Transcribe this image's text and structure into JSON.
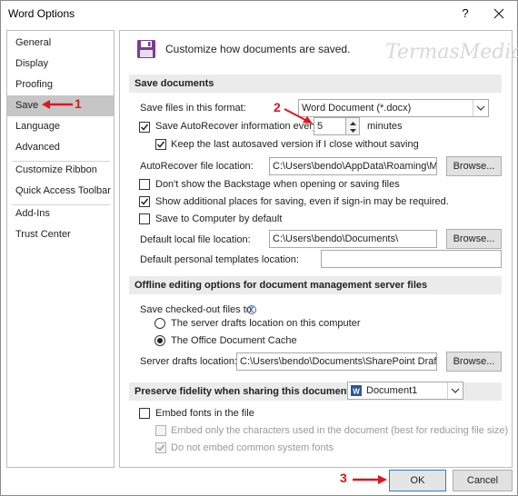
{
  "window": {
    "title": "Word Options",
    "help_label": "?"
  },
  "watermark": "TermasMedia",
  "nav": {
    "items": [
      {
        "label": "General"
      },
      {
        "label": "Display"
      },
      {
        "label": "Proofing"
      },
      {
        "label": "Save",
        "selected": true
      },
      {
        "label": "Language"
      },
      {
        "label": "Advanced"
      },
      {
        "label": "Customize Ribbon"
      },
      {
        "label": "Quick Access Toolbar"
      },
      {
        "label": "Add-Ins"
      },
      {
        "label": "Trust Center"
      }
    ]
  },
  "header": {
    "text": "Customize how documents are saved.",
    "icon": "save-disk-icon"
  },
  "save_documents": {
    "section_title": "Save documents",
    "format_label": "Save files in this format:",
    "format_value": "Word Document (*.docx)",
    "autorecover_label": "Save AutoRecover information every",
    "autorecover_checked": true,
    "autorecover_minutes": "5",
    "minutes_label": "minutes",
    "keep_last_label": "Keep the last autosaved version if I close without saving",
    "keep_last_checked": true,
    "autorecover_location_label": "AutoRecover file location:",
    "autorecover_location_value": "C:\\Users\\bendo\\AppData\\Roaming\\Mic",
    "browse_label": "Browse...",
    "dont_show_backstage_label": "Don't show the Backstage when opening or saving files",
    "dont_show_backstage_checked": false,
    "show_additional_label": "Show additional places for saving, even if sign-in may be required.",
    "show_additional_checked": true,
    "save_to_computer_label": "Save to Computer by default",
    "save_to_computer_checked": false,
    "default_local_label": "Default local file location:",
    "default_local_value": "C:\\Users\\bendo\\Documents\\",
    "default_templates_label": "Default personal templates location:",
    "default_templates_value": ""
  },
  "offline": {
    "section_title": "Offline editing options for document management server files",
    "save_checked_out_label": "Save checked-out files to:",
    "radio_server_label": "The server drafts location on this computer",
    "radio_cache_label": "The Office Document Cache",
    "selected": "cache",
    "server_drafts_label": "Server drafts location:",
    "server_drafts_value": "C:\\Users\\bendo\\Documents\\SharePoint Drafts\\",
    "browse_label": "Browse..."
  },
  "fidelity": {
    "section_title": "Preserve fidelity when sharing this document:",
    "document_value": "Document1",
    "embed_fonts_label": "Embed fonts in the file",
    "embed_fonts_checked": false,
    "embed_only_label": "Embed only the characters used in the document (best for reducing file size)",
    "do_not_embed_label": "Do not embed common system fonts"
  },
  "footer": {
    "ok_label": "OK",
    "cancel_label": "Cancel"
  },
  "annotations": {
    "step1": "1",
    "step2": "2",
    "step3": "3",
    "color": "#e0141e"
  }
}
